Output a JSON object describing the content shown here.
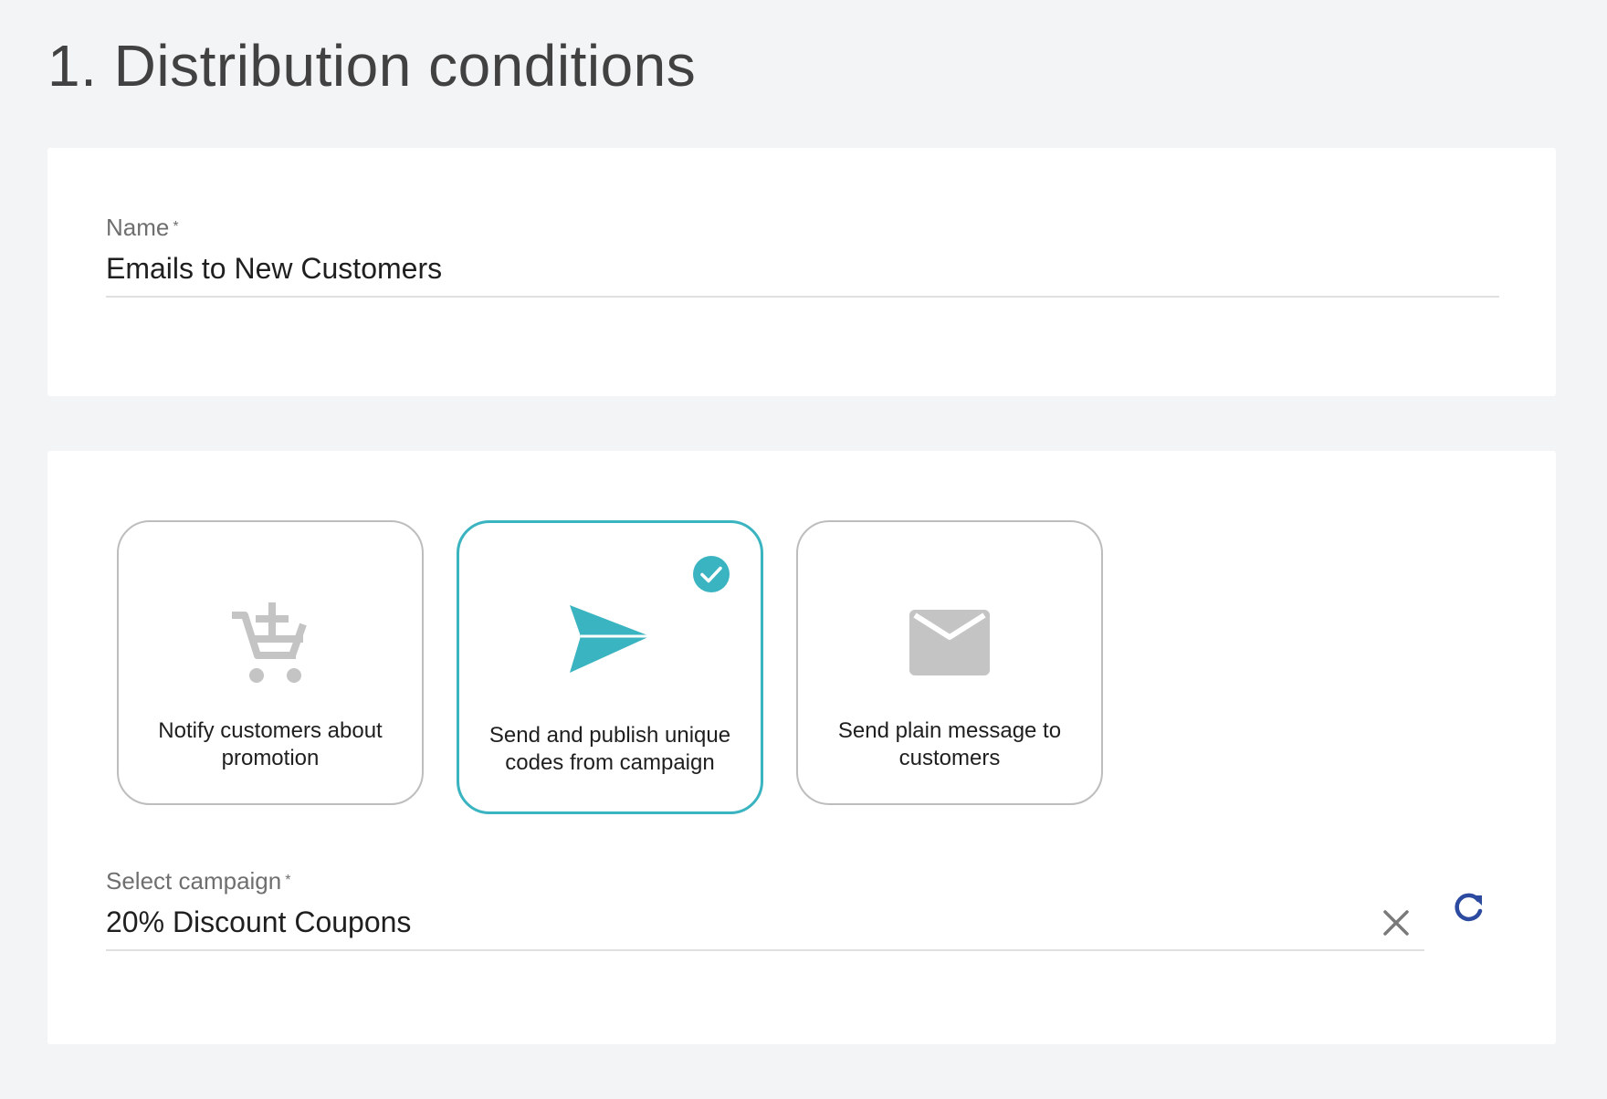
{
  "page": {
    "title": "1. Distribution conditions"
  },
  "name_field": {
    "label": "Name",
    "required_marker": "*",
    "value": "Emails to New Customers"
  },
  "distribution_types": [
    {
      "label": "Notify customers about promotion",
      "icon": "cart-plus-icon",
      "selected": false
    },
    {
      "label": "Send and publish unique codes from campaign",
      "icon": "paper-plane-icon",
      "selected": true
    },
    {
      "label": "Send plain message to customers",
      "icon": "envelope-icon",
      "selected": false
    }
  ],
  "campaign_field": {
    "label": "Select campaign",
    "required_marker": "*",
    "value": "20% Discount Coupons",
    "clear_icon": "close-icon",
    "refresh_icon": "refresh-icon"
  },
  "colors": {
    "accent": "#3ab4c0",
    "refresh": "#2b4aa0",
    "inactive_icon": "#c4c4c4",
    "background": "#f3f4f6"
  }
}
